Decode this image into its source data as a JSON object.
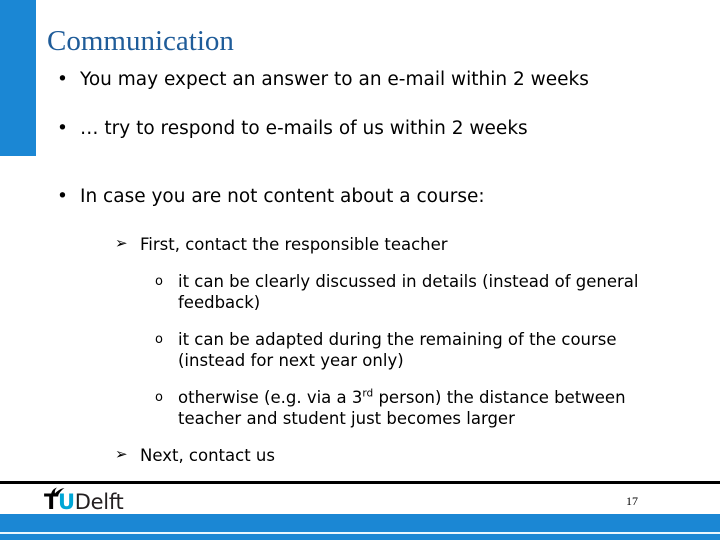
{
  "slide": {
    "title": "Communication",
    "page_number": "17",
    "accent_color": "#1b87d4",
    "title_color": "#1f5c99",
    "logo": {
      "mark_icon": "tu-delft-flame-icon",
      "t": "T",
      "u": "U",
      "delft": "Delft",
      "u_color": "#00a6d6"
    },
    "bullets": {
      "level1": [
        {
          "marker": "•",
          "text": "You may expect an answer to an e-mail within 2 weeks"
        },
        {
          "marker": "•",
          "text": "… try to respond to e-mails of us within 2 weeks"
        },
        {
          "marker": "•",
          "text": "In case you are not content about a course:"
        }
      ],
      "level2": [
        {
          "marker": "➢",
          "text": "First, contact the responsible teacher"
        },
        {
          "marker": "➢",
          "text": "Next, contact us"
        }
      ],
      "level3": [
        {
          "marker": "o",
          "text": "it can be clearly discussed in details (instead of general feedback)"
        },
        {
          "marker": "o",
          "text": "it can be adapted during the remaining of the course (instead for next year only)"
        },
        {
          "marker": "o",
          "text_before": "otherwise (e.g. via a 3",
          "superscript": "rd",
          "text_after": " person) the distance between teacher and student just becomes larger"
        }
      ]
    }
  }
}
